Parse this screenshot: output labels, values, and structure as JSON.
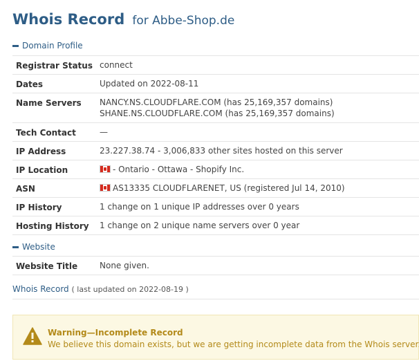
{
  "header": {
    "title": "Whois Record",
    "subtitle": "for Abbe-Shop.de"
  },
  "domain_profile": {
    "heading": "Domain Profile",
    "rows": [
      {
        "label": "Registrar Status",
        "lines": [
          "connect"
        ]
      },
      {
        "label": "Dates",
        "lines": [
          "Updated on 2022-08-11"
        ]
      },
      {
        "label": "Name Servers",
        "lines": [
          "NANCY.NS.CLOUDFLARE.COM (has 25,169,357 domains)",
          "SHANE.NS.CLOUDFLARE.COM (has 25,169,357 domains)"
        ]
      },
      {
        "label": "Tech Contact",
        "lines": [
          "—"
        ]
      },
      {
        "label": "IP Address",
        "lines": [
          "23.227.38.74 - 3,006,833 other sites hosted on this server"
        ]
      },
      {
        "label": "IP Location",
        "lines": [
          "- Ontario - Ottawa - Shopify Inc."
        ],
        "flag": "canada-flag-icon"
      },
      {
        "label": "ASN",
        "lines": [
          "AS13335 CLOUDFLARENET, US (registered Jul 14, 2010)"
        ],
        "flag": "canada-flag-icon"
      },
      {
        "label": "IP History",
        "lines": [
          "1 change on 1 unique IP addresses over 0 years"
        ]
      },
      {
        "label": "Hosting History",
        "lines": [
          "1 change on 2 unique name servers over 0 year"
        ]
      }
    ]
  },
  "website": {
    "heading": "Website",
    "rows": [
      {
        "label": "Website Title",
        "lines": [
          "None given."
        ]
      }
    ]
  },
  "whois_record": {
    "title": "Whois Record",
    "updated": "( last updated on 2022-08-19 )"
  },
  "warning": {
    "icon": "warning-triangle-icon",
    "title": "Warning—Incomplete Record",
    "message": "We believe this domain exists, but we are getting incomplete data from the Whois server."
  },
  "colors": {
    "accent": "#2e5d86",
    "warning_bg": "#fcf8e3",
    "warning_text": "#b38a1a"
  }
}
